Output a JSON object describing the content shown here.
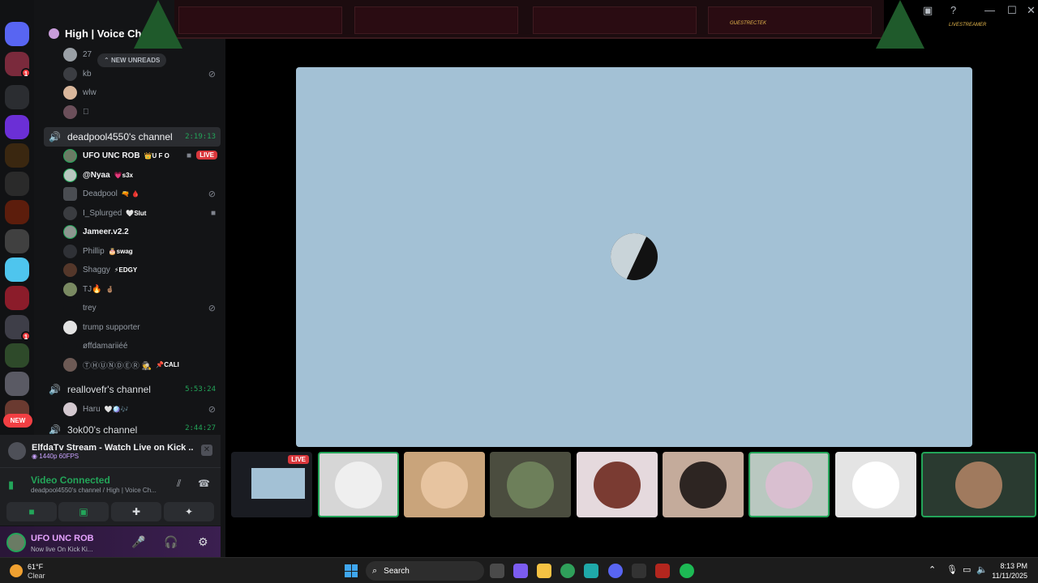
{
  "server": {
    "name": "High | Voice Chat",
    "new_unreads": "NEW UNREADS"
  },
  "rail": {
    "badges": [
      "1",
      "1"
    ],
    "new_pill": "NEW"
  },
  "top_users": [
    {
      "name": "27",
      "muted": false
    },
    {
      "name": "kb",
      "muted": true
    },
    {
      "name": "wlw",
      "muted": false
    },
    {
      "name": "\u0000",
      "muted": false
    }
  ],
  "channels": {
    "active": {
      "name": "deadpool4550's channel",
      "time": "2:19:13"
    },
    "second": {
      "name": "reallovefr's channel",
      "time": "5:53:24"
    },
    "third": {
      "name": "3ok00's channel",
      "time": "2:44:27"
    }
  },
  "members": [
    {
      "name": "UFO UNC ROB",
      "tag": "👑U F O",
      "bright": true,
      "camera": true,
      "live": "LIVE"
    },
    {
      "name": "@Nyaa",
      "tag": "💗s3x",
      "bright": true
    },
    {
      "name": "Deadpool",
      "tag": "🔫 🩸",
      "bright": false,
      "muted": true
    },
    {
      "name": "I_Splurged",
      "tag": "🤍Slut",
      "bright": false,
      "camera": true
    },
    {
      "name": "Jameer.v2.2",
      "tag": "",
      "bright": true
    },
    {
      "name": "Phillip",
      "tag": "🎂swag",
      "bright": false
    },
    {
      "name": "Shaggy",
      "tag": "⚡EDGY",
      "bright": false
    },
    {
      "name": "TJ🔥",
      "tag": "🤞🏽",
      "bright": false
    },
    {
      "name": "trey",
      "tag": "",
      "bright": false,
      "muted": true
    },
    {
      "name": "trump supporter",
      "tag": "",
      "bright": false
    },
    {
      "name": "øffdamariiéé",
      "tag": "",
      "bright": false
    },
    {
      "name": "ⓉⒽⓊⓃⒹⒺⓇ 🕵",
      "tag": "📌CALI",
      "bright": false
    }
  ],
  "second_channel_member": {
    "name": "Haru",
    "tag": "🤍🪩🎶"
  },
  "stream_notice": {
    "title": "ElfdaTv Stream - Watch Live on Kick ...",
    "sub": "1440p 60FPS"
  },
  "voice_panel": {
    "status": "Video Connected",
    "sub": "deadpool4550's channel / High | Voice Ch..."
  },
  "user_panel": {
    "name": "UFO UNC ROB",
    "status": "Now live On Kick Ki..."
  },
  "banner": {
    "guest_label": "GUESTRECTEK",
    "streamer_label": "LIVESTREAMER"
  },
  "strip": {
    "live_label": "LIVE"
  },
  "taskbar": {
    "temperature": "61°F",
    "condition": "Clear",
    "search_placeholder": "Search",
    "time": "8:13 PM",
    "date": "11/11/2025"
  },
  "colors": {
    "accent_green": "#23a559",
    "live_red": "#da373c",
    "video_bg": "#a3c1d5"
  }
}
